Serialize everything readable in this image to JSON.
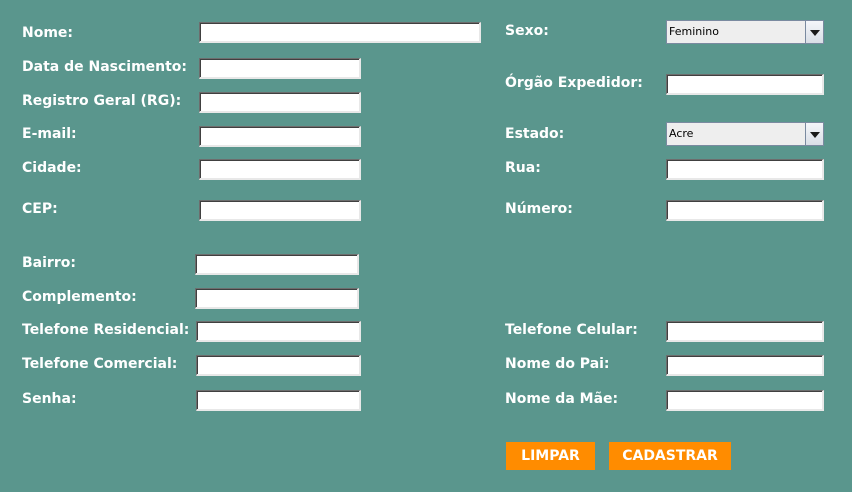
{
  "form": {
    "nome": {
      "label": "Nome:",
      "value": ""
    },
    "data_nascimento": {
      "label": "Data de Nascimento:",
      "value": ""
    },
    "rg": {
      "label": "Registro Geral (RG):",
      "value": ""
    },
    "email": {
      "label": "E-mail:",
      "value": ""
    },
    "cidade": {
      "label": "Cidade:",
      "value": ""
    },
    "cep": {
      "label": "CEP:",
      "value": ""
    },
    "bairro": {
      "label": "Bairro:",
      "value": ""
    },
    "complemento": {
      "label": "Complemento:",
      "value": ""
    },
    "tel_residencial": {
      "label": "Telefone Residencial:",
      "value": ""
    },
    "tel_comercial": {
      "label": "Telefone Comercial:",
      "value": ""
    },
    "senha": {
      "label": "Senha:",
      "value": ""
    },
    "sexo": {
      "label": "Sexo:",
      "selected": "Feminino"
    },
    "orgao_expedidor": {
      "label": "Órgão Expedidor:",
      "value": ""
    },
    "estado": {
      "label": "Estado:",
      "selected": "Acre"
    },
    "rua": {
      "label": "Rua:",
      "value": ""
    },
    "numero": {
      "label": "Número:",
      "value": ""
    },
    "tel_celular": {
      "label": "Telefone Celular:",
      "value": ""
    },
    "nome_pai": {
      "label": "Nome do Pai:",
      "value": ""
    },
    "nome_mae": {
      "label": "Nome da Mãe:",
      "value": ""
    }
  },
  "buttons": {
    "limpar": "LIMPAR",
    "cadastrar": "CADASTRAR"
  },
  "colors": {
    "background": "#5a968d",
    "button": "#ff8c00",
    "label": "#ffffff"
  },
  "icons": {
    "dropdown": "chevron-down-icon"
  }
}
